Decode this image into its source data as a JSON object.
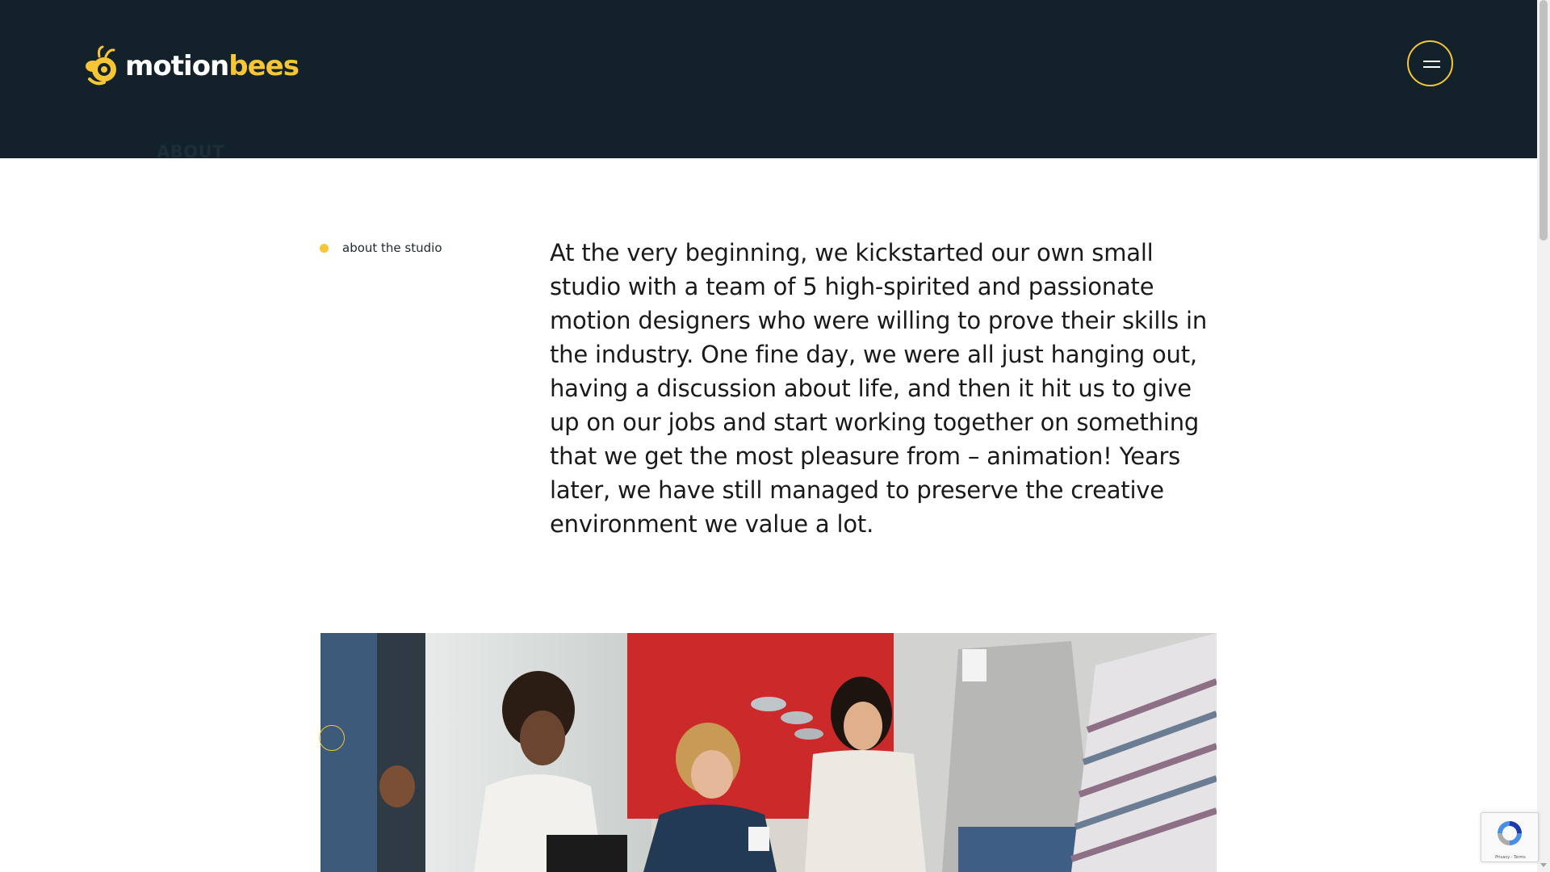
{
  "header": {
    "logo": {
      "part1": "motion",
      "part2": "bees",
      "icon": "bee-icon"
    },
    "menu_icon": "hamburger-menu-icon",
    "nav_hint": "ABOUT"
  },
  "content": {
    "section_label": "about the studio",
    "intro_text": "At the very beginning, we kickstarted our own small studio with a team of 5 high-spirited and passionate motion designers who were willing to prove their skills in the industry. One fine day, we were all just hanging out, having a discussion about life, and then it hit us to give up on our jobs and start working together on something that we get the most pleasure from – animation! Years later, we have still managed to preserve the creative environment we value a lot."
  },
  "recaptcha": {
    "links": "Privacy - Terms"
  },
  "colors": {
    "header_bg": "#13222a",
    "accent": "#f7c536",
    "text": "#1a1a1a",
    "page_bg": "#ffffff"
  }
}
